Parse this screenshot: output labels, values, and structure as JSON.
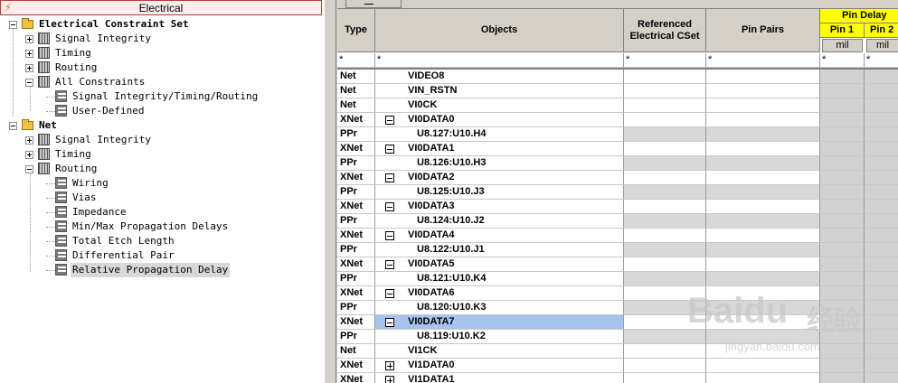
{
  "left_panel": {
    "header_title": "Electrical",
    "tree": [
      {
        "label": "Electrical Constraint Set",
        "level": 0,
        "icon": "folder-open-icon",
        "bold": true,
        "expander": "minus"
      },
      {
        "label": "Signal Integrity",
        "level": 1,
        "icon": "grid-workbook-icon",
        "expander": "plus"
      },
      {
        "label": "Timing",
        "level": 1,
        "icon": "grid-workbook-icon",
        "expander": "plus"
      },
      {
        "label": "Routing",
        "level": 1,
        "icon": "grid-workbook-icon",
        "expander": "plus"
      },
      {
        "label": "All Constraints",
        "level": 1,
        "icon": "grid-workbook-icon",
        "expander": "minus"
      },
      {
        "label": "Signal Integrity/Timing/Routing",
        "level": 2,
        "icon": "worksheet-icon"
      },
      {
        "label": "User-Defined",
        "level": 2,
        "icon": "worksheet-icon"
      },
      {
        "label": "Net",
        "level": 0,
        "icon": "folder-open-icon",
        "bold": true,
        "expander": "minus"
      },
      {
        "label": "Signal Integrity",
        "level": 1,
        "icon": "grid-workbook-icon",
        "expander": "plus"
      },
      {
        "label": "Timing",
        "level": 1,
        "icon": "grid-workbook-icon",
        "expander": "plus"
      },
      {
        "label": "Routing",
        "level": 1,
        "icon": "grid-workbook-icon",
        "expander": "minus"
      },
      {
        "label": "Wiring",
        "level": 2,
        "icon": "worksheet-icon"
      },
      {
        "label": "Vias",
        "level": 2,
        "icon": "worksheet-icon"
      },
      {
        "label": "Impedance",
        "level": 2,
        "icon": "worksheet-icon"
      },
      {
        "label": "Min/Max Propagation Delays",
        "level": 2,
        "icon": "worksheet-icon"
      },
      {
        "label": "Total Etch Length",
        "level": 2,
        "icon": "worksheet-icon"
      },
      {
        "label": "Differential Pair",
        "level": 2,
        "icon": "worksheet-icon"
      },
      {
        "label": "Relative Propagation Delay",
        "level": 2,
        "icon": "worksheet-icon",
        "selected": true
      }
    ]
  },
  "grid": {
    "headers": {
      "type": "Type",
      "objects": "Objects",
      "referenced": "Referenced Electrical CSet",
      "pin_pairs": "Pin Pairs",
      "pin_delay": "Pin Delay",
      "pin1": "Pin 1",
      "pin2": "Pin 2",
      "unit1": "mil",
      "unit2": "mil"
    },
    "filter_row": {
      "type": "*",
      "objects": "*",
      "referenced": "*",
      "pin_pairs": "*",
      "pin1": "*",
      "pin2": "*"
    },
    "rows": [
      {
        "type": "Net",
        "object": "VIDEO8"
      },
      {
        "type": "Net",
        "object": "VIN_RSTN"
      },
      {
        "type": "Net",
        "object": "VI0CK"
      },
      {
        "type": "XNet",
        "object": "VI0DATA0",
        "expander": "minus"
      },
      {
        "type": "PPr",
        "object": "U8.127:U10.H4"
      },
      {
        "type": "XNet",
        "object": "VI0DATA1",
        "expander": "minus"
      },
      {
        "type": "PPr",
        "object": "U8.126:U10.H3"
      },
      {
        "type": "XNet",
        "object": "VI0DATA2",
        "expander": "minus"
      },
      {
        "type": "PPr",
        "object": "U8.125:U10.J3"
      },
      {
        "type": "XNet",
        "object": "VI0DATA3",
        "expander": "minus"
      },
      {
        "type": "PPr",
        "object": "U8.124:U10.J2"
      },
      {
        "type": "XNet",
        "object": "VI0DATA4",
        "expander": "minus"
      },
      {
        "type": "PPr",
        "object": "U8.122:U10.J1"
      },
      {
        "type": "XNet",
        "object": "VI0DATA5",
        "expander": "minus"
      },
      {
        "type": "PPr",
        "object": "U8.121:U10.K4"
      },
      {
        "type": "XNet",
        "object": "VI0DATA6",
        "expander": "minus"
      },
      {
        "type": "PPr",
        "object": "U8.120:U10.K3"
      },
      {
        "type": "XNet",
        "object": "VI0DATA7",
        "expander": "minus",
        "selected": true
      },
      {
        "type": "PPr",
        "object": "U8.119:U10.K2"
      },
      {
        "type": "Net",
        "object": "VI1CK"
      },
      {
        "type": "XNet",
        "object": "VI1DATA0",
        "expander": "plus"
      },
      {
        "type": "XNet",
        "object": "VI1DATA1",
        "expander": "plus"
      }
    ]
  },
  "watermark": {
    "brand": "Baidu",
    "cn": "经验",
    "url": "jingyan.baidu.com"
  },
  "colors": {
    "header_bg": "#d4d0c8",
    "pin_delay_header": "#ffff00",
    "selected_row": "#a6c2ee",
    "left_header_border": "#b04040"
  }
}
